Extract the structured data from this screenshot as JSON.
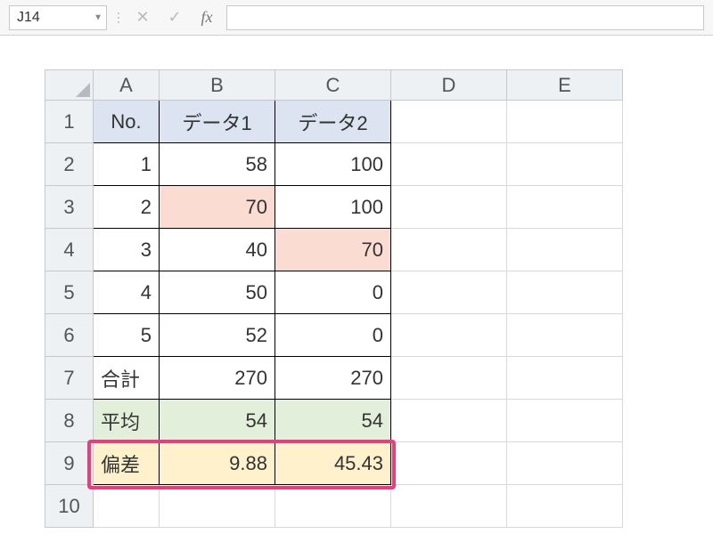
{
  "name_box": {
    "value": "J14"
  },
  "formula_bar": {
    "value": "",
    "fx_label": "fx",
    "cancel_icon": "✕",
    "confirm_icon": "✓"
  },
  "columns": [
    "A",
    "B",
    "C",
    "D",
    "E"
  ],
  "row_numbers": [
    "1",
    "2",
    "3",
    "4",
    "5",
    "6",
    "7",
    "8",
    "9",
    "10"
  ],
  "rows": {
    "r1": {
      "a": "No.",
      "b": "データ1",
      "c": "データ2"
    },
    "r2": {
      "a": "1",
      "b": "58",
      "c": "100"
    },
    "r3": {
      "a": "2",
      "b": "70",
      "c": "100"
    },
    "r4": {
      "a": "3",
      "b": "40",
      "c": "70"
    },
    "r5": {
      "a": "4",
      "b": "50",
      "c": "0"
    },
    "r6": {
      "a": "5",
      "b": "52",
      "c": "0"
    },
    "r7": {
      "a": "合計",
      "b": "270",
      "c": "270"
    },
    "r8": {
      "a": "平均",
      "b": "54",
      "c": "54"
    },
    "r9": {
      "a": "偏差",
      "b": "9.88",
      "c": "45.43"
    }
  },
  "chart_data": {
    "type": "table",
    "title": "",
    "columns": [
      "No.",
      "データ1",
      "データ2"
    ],
    "data": [
      {
        "No.": 1,
        "データ1": 58,
        "データ2": 100
      },
      {
        "No.": 2,
        "データ1": 70,
        "データ2": 100
      },
      {
        "No.": 3,
        "データ1": 40,
        "データ2": 70
      },
      {
        "No.": 4,
        "データ1": 50,
        "データ2": 0
      },
      {
        "No.": 5,
        "データ1": 52,
        "データ2": 0
      }
    ],
    "summary": {
      "合計": {
        "データ1": 270,
        "データ2": 270
      },
      "平均": {
        "データ1": 54,
        "データ2": 54
      },
      "偏差": {
        "データ1": 9.88,
        "データ2": 45.43
      }
    }
  }
}
